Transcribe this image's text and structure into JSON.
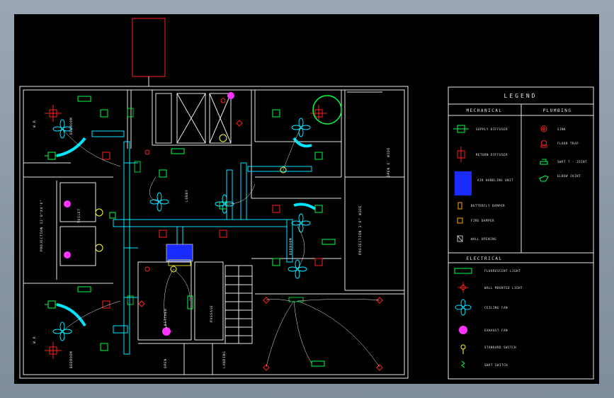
{
  "legend": {
    "title": "LEGEND",
    "mechanical_heading": "MECHANICAL",
    "plumbing_heading": "PLUMBING",
    "electrical_heading": "ELECTRICAL",
    "mechanical_items": [
      "SUPPLY DIFFUSER",
      "RETURN DIFFUSER",
      "AIR HANDLING UNIT",
      "BUTTERFLY DAMPER",
      "FIRE DAMPER",
      "WALL OPENING"
    ],
    "plumbing_items": [
      "SINK",
      "FLOOR TRAP",
      "SWAT T - JOINT",
      "ELBOW JOINT"
    ],
    "electrical_items": [
      "FLUORESCENT LIGHT",
      "WALL MOUNTED LIGHT",
      "CEILING FAN",
      "EXHAUST FAN",
      "STANDARD SWITCH",
      "SWAT SWITCH"
    ]
  },
  "rooms": {
    "wr_top": "W.R",
    "wr_bottom": "W.R",
    "projection_left": "PROJECTION 12'0\"X4'6\"",
    "projection_right": "PROJECTION 3'6\" WIDE",
    "open_right": "OPEN 6' WIDE",
    "lobby": "LOBBY",
    "passage": "PASSAGE",
    "open_bottom": "OPEN",
    "landing": "LANDING",
    "kitchen": "KITCHEN",
    "bedroom_top": "BEDROOM",
    "bedroom_bottom": "BEDROOM",
    "bedroom_right": "BEDROOM",
    "toilet": "TOILET"
  },
  "colors": {
    "background": "#000000",
    "wall": "#e8e8e8",
    "duct": "#00e5ff",
    "supply": "#00ff44",
    "return": "#ff2020",
    "ahu": "#1a2bff",
    "exhaust": "#ff33ff",
    "switch": "#ffff33"
  }
}
